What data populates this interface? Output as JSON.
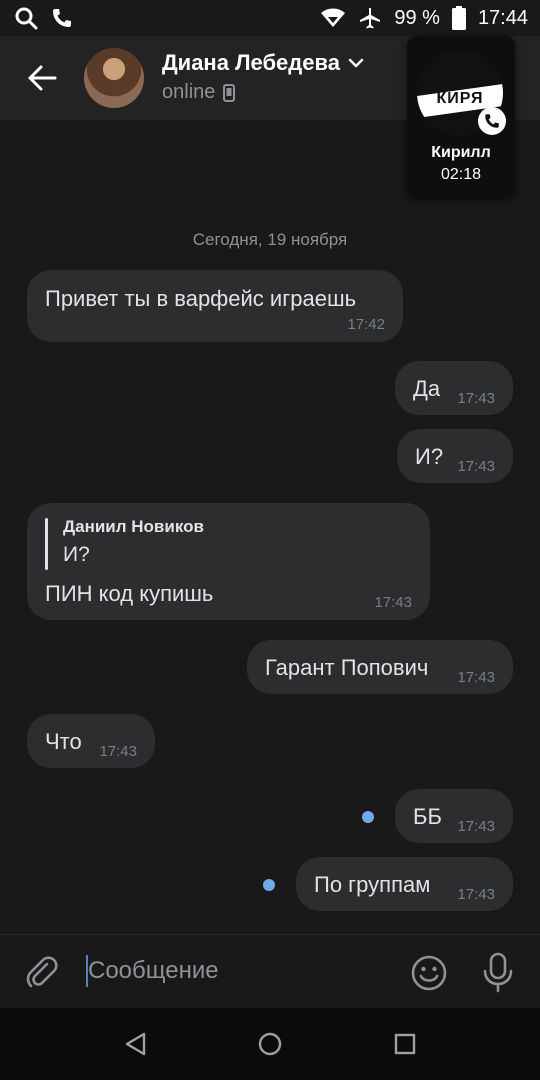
{
  "status_bar": {
    "battery_text": "99 %",
    "time": "17:44",
    "icons": [
      "search-icon",
      "phone-icon",
      "wifi-icon",
      "airplane-icon",
      "battery-icon"
    ]
  },
  "header": {
    "contact_name": "Диана Лебедева",
    "status": "online",
    "icons": [
      "back-arrow-icon",
      "chevron-down-icon",
      "mobile-device-icon"
    ]
  },
  "call_card": {
    "avatar_text": "КИРЯ",
    "name": "Кирилл",
    "duration": "02:18",
    "icons": [
      "phone-badge-icon"
    ]
  },
  "chat": {
    "date_separator": "Сегодня, 19 ноября",
    "messages": [
      {
        "direction": "incoming",
        "text": "Привет ты в варфейс играешь",
        "time": "17:42"
      },
      {
        "direction": "outgoing",
        "text": "Да",
        "time": "17:43"
      },
      {
        "direction": "outgoing",
        "text": "И?",
        "time": "17:43"
      },
      {
        "direction": "incoming",
        "reply_to_name": "Даниил Новиков",
        "reply_to_text": "И?",
        "text": "ПИН код купишь",
        "time": "17:43"
      },
      {
        "direction": "outgoing",
        "text": "Гарант Попович",
        "time": "17:43"
      },
      {
        "direction": "incoming",
        "text": "Что",
        "time": "17:43"
      },
      {
        "direction": "outgoing",
        "text": "ББ",
        "time": "17:43",
        "unread_dot": true
      },
      {
        "direction": "outgoing",
        "text": "По группам",
        "time": "17:43",
        "unread_dot": true
      }
    ]
  },
  "composer": {
    "placeholder": "Сообщение",
    "icons": [
      "attach-icon",
      "emoji-icon",
      "microphone-icon"
    ]
  },
  "nav_bar": {
    "icons": [
      "nav-back-icon",
      "nav-home-icon",
      "nav-recents-icon"
    ]
  },
  "colors": {
    "background": "#19191a",
    "header": "#232324",
    "bubble": "#2c2d2e",
    "accent": "#71aaeb",
    "muted_text": "#8e9297"
  }
}
